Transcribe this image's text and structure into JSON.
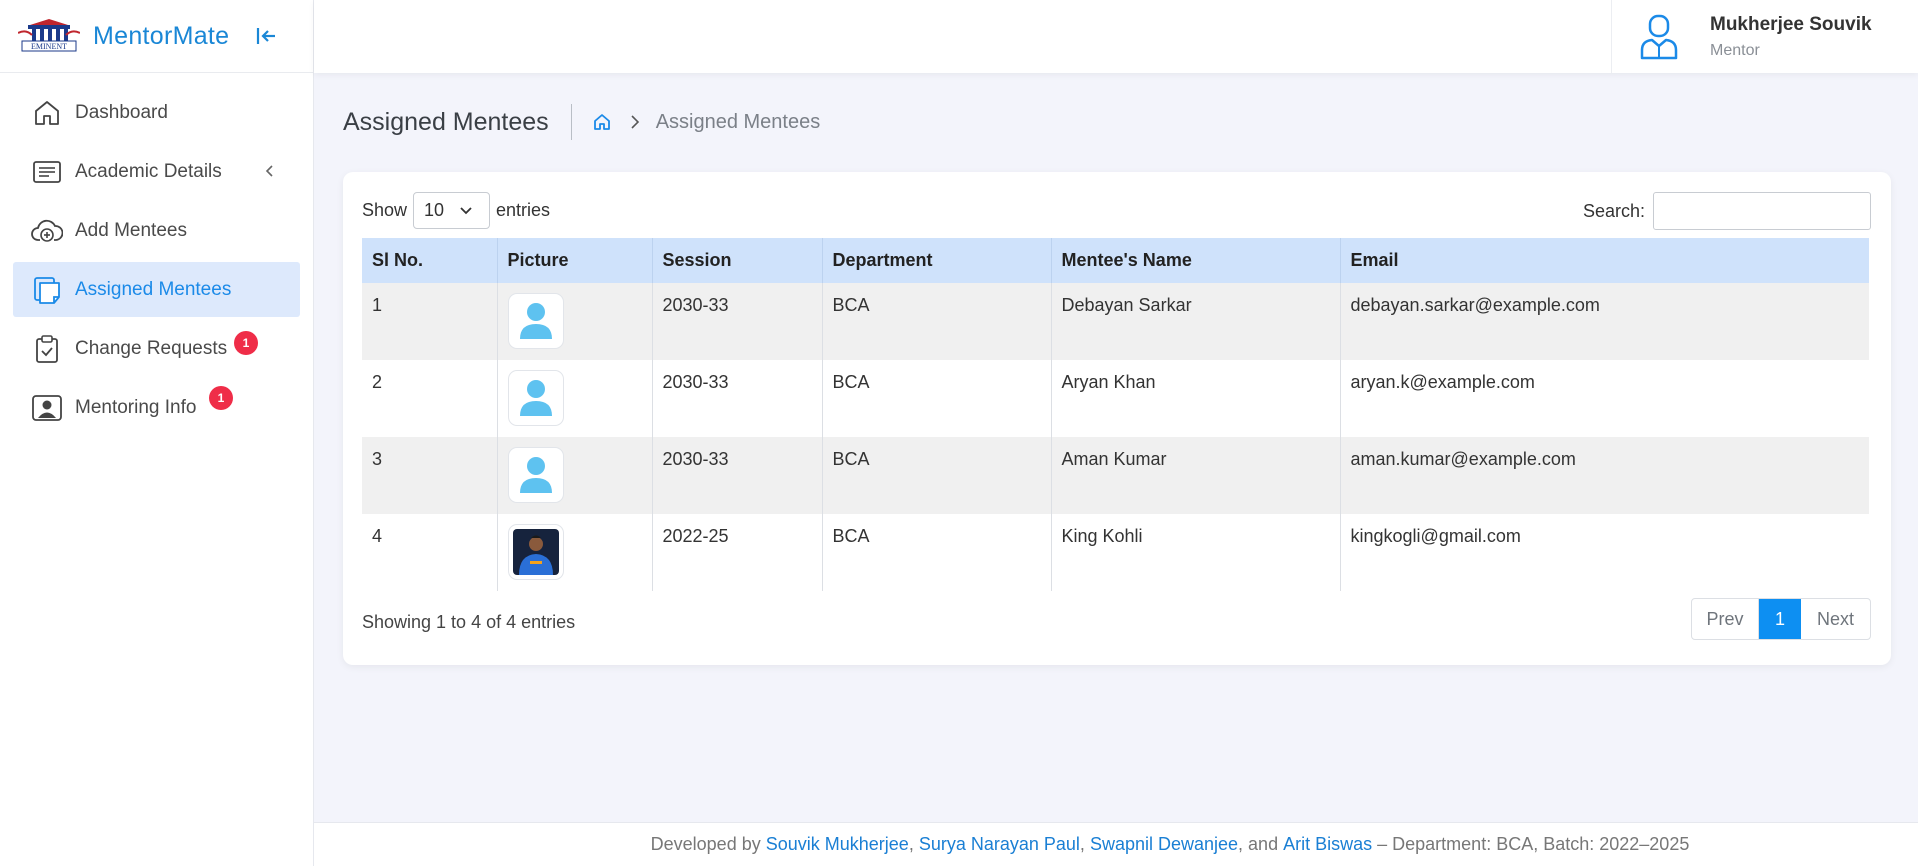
{
  "brand": {
    "logo_text": "EMINENT",
    "name": "MentorMate"
  },
  "sidebar": {
    "items": [
      {
        "label": "Dashboard",
        "icon": "home-icon"
      },
      {
        "label": "Academic Details",
        "icon": "document-list-icon"
      },
      {
        "label": "Add Mentees",
        "icon": "cloud-upload-icon"
      },
      {
        "label": "Assigned Mentees",
        "icon": "stacked-pages-icon",
        "active": true
      },
      {
        "label": "Change Requests",
        "icon": "clipboard-check-icon",
        "badge": "1"
      },
      {
        "label": "Mentoring Info",
        "icon": "person-card-icon",
        "badge": "1"
      }
    ]
  },
  "user": {
    "name": "Mukherjee Souvik",
    "role": "Mentor"
  },
  "page": {
    "title": "Assigned Mentees",
    "breadcrumb_current": "Assigned Mentees"
  },
  "table_controls": {
    "show_label": "Show",
    "page_size": "10",
    "entries_label": "entries",
    "search_label": "Search:"
  },
  "table": {
    "columns": [
      "Sl No.",
      "Picture",
      "Session",
      "Department",
      "Mentee's Name",
      "Email"
    ],
    "rows": [
      {
        "sl": "1",
        "session": "2030-33",
        "department": "BCA",
        "name": "Debayan Sarkar",
        "email": "debayan.sarkar@example.com",
        "picture": "default-avatar"
      },
      {
        "sl": "2",
        "session": "2030-33",
        "department": "BCA",
        "name": "Aryan Khan",
        "email": "aryan.k@example.com",
        "picture": "default-avatar"
      },
      {
        "sl": "3",
        "session": "2030-33",
        "department": "BCA",
        "name": "Aman Kumar",
        "email": "aman.kumar@example.com",
        "picture": "default-avatar"
      },
      {
        "sl": "4",
        "session": "2022-25",
        "department": "BCA",
        "name": "King Kohli",
        "email": "kingkogli@gmail.com",
        "picture": "photo"
      }
    ]
  },
  "pagination": {
    "info": "Showing 1 to 4 of 4 entries",
    "prev": "Prev",
    "current": "1",
    "next": "Next"
  },
  "footer": {
    "prefix": "Developed by",
    "dev1": "Souvik Mukherjee",
    "dev2": "Surya Narayan Paul",
    "dev3": "Swapnil Dewanjee",
    "and": "and",
    "dev4": "Arit Biswas",
    "suffix": "– Department: BCA, Batch: 2022–2025"
  },
  "colors": {
    "accent": "#1a87d6",
    "active_bg": "#dde9fc",
    "badge": "#ef2d48",
    "table_header": "#cfe2fb",
    "page_active": "#0d8ff2"
  }
}
